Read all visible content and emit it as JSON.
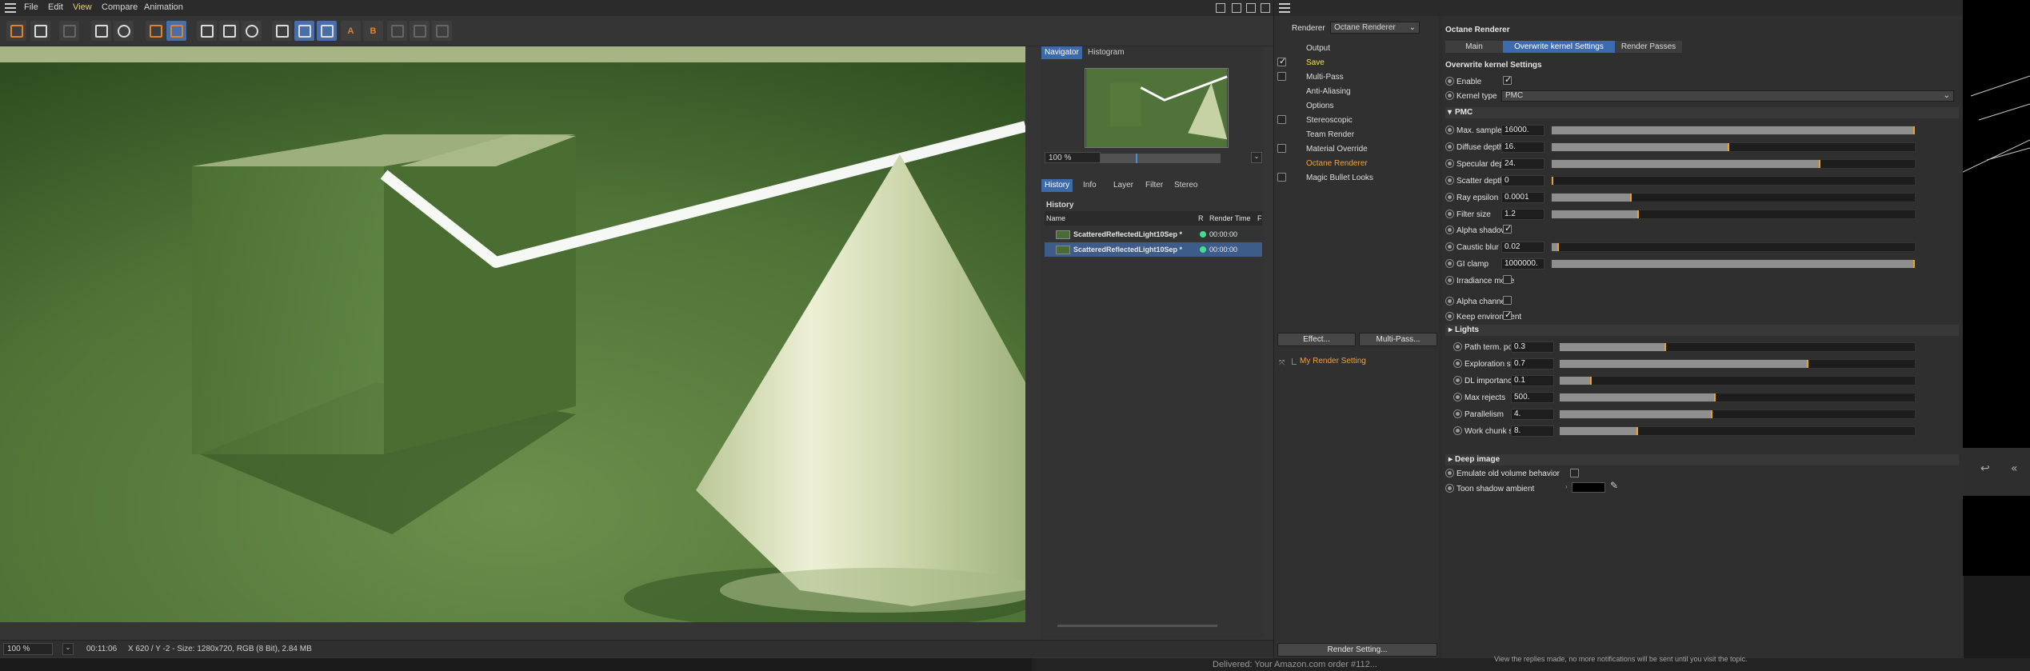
{
  "menubar": {
    "items": [
      "File",
      "Edit",
      "View",
      "Compare",
      "Animation"
    ],
    "active": "View"
  },
  "status": {
    "zoom": "100 %",
    "time": "00:11:06",
    "info": "X 620 / Y -2 - Size: 1280x720, RGB (8 Bit), 2.84 MB"
  },
  "navigator": {
    "tabs": [
      "Navigator",
      "Histogram"
    ],
    "zoom": "100 %",
    "history_tabs": [
      "History",
      "Info",
      "Layer",
      "Filter",
      "Stereo"
    ],
    "history_title": "History",
    "columns": [
      "Name",
      "R",
      "Render Time",
      "F"
    ],
    "rows": [
      {
        "name": "ScatteredReflectedLight10Sep *",
        "time": "00:00:00"
      },
      {
        "name": "ScatteredReflectedLight10Sep *",
        "time": "00:00:00"
      }
    ]
  },
  "render_settings": {
    "renderer_label": "Renderer",
    "renderer_value": "Octane Renderer",
    "nav": [
      {
        "label": "Output",
        "checkbox": false,
        "checked": false
      },
      {
        "label": "Save",
        "checkbox": true,
        "checked": true
      },
      {
        "label": "Multi-Pass",
        "checkbox": true,
        "checked": false
      },
      {
        "label": "Anti-Aliasing",
        "checkbox": false,
        "checked": false
      },
      {
        "label": "Options",
        "checkbox": false,
        "checked": false
      },
      {
        "label": "Stereoscopic",
        "checkbox": true,
        "checked": false
      },
      {
        "label": "Team Render",
        "checkbox": false,
        "checked": false
      },
      {
        "label": "Material Override",
        "checkbox": true,
        "checked": false
      },
      {
        "label": "Octane Renderer",
        "checkbox": false,
        "checked": false
      },
      {
        "label": "Magic Bullet Looks",
        "checkbox": true,
        "checked": false
      }
    ],
    "effect_button": "Effect...",
    "multipass_button": "Multi-Pass...",
    "setting_name": "My Render Setting",
    "render_setting_button": "Render Setting..."
  },
  "octane": {
    "title": "Octane Renderer",
    "tabs": [
      "Main",
      "Overwrite kernel Settings",
      "Render Passes"
    ],
    "active_tab": "Overwrite kernel Settings",
    "section_title": "Overwrite kernel Settings",
    "enable_label": "Enable",
    "kernel_type_label": "Kernel type",
    "kernel_type_value": "PMC",
    "pmc_header": "PMC",
    "params": [
      {
        "label": "Max. samples",
        "value": "16000.",
        "fill": 1.0
      },
      {
        "label": "Diffuse depth",
        "value": "16.",
        "fill": 0.49
      },
      {
        "label": "Specular depth",
        "value": "24.",
        "fill": 0.74
      },
      {
        "label": "Scatter depth",
        "value": "0",
        "fill": 0.0
      },
      {
        "label": "Ray epsilon",
        "value": "0.0001",
        "fill": 0.22
      },
      {
        "label": "Filter size",
        "value": "1.2",
        "fill": 0.24
      },
      {
        "label": "Caustic blur",
        "value": "0.02",
        "fill": 0.02
      },
      {
        "label": "GI clamp",
        "value": "1000000.",
        "fill": 1.0
      }
    ],
    "alpha_shadows": "Alpha shadows",
    "irradiance_mode": "Irradiance mode",
    "alpha_channel": "Alpha channel",
    "keep_environment": "Keep environment",
    "lights_header": "Lights",
    "light_params": [
      {
        "label": "Path term. power",
        "value": "0.3",
        "fill": 0.3
      },
      {
        "label": "Exploration strength",
        "value": "0.7",
        "fill": 0.7
      },
      {
        "label": "DL importance",
        "value": "0.1",
        "fill": 0.09
      },
      {
        "label": "Max rejects",
        "value": "500.",
        "fill": 0.44
      },
      {
        "label": "Parallelism",
        "value": "4.",
        "fill": 0.43
      },
      {
        "label": "Work chunk size",
        "value": "8.",
        "fill": 0.22
      }
    ],
    "deep_image_header": "Deep image",
    "emulate_label": "Emulate old volume behavior",
    "toon_label": "Toon shadow ambient"
  },
  "colors": {
    "accent": "#3b6bb0",
    "highlight": "#f0a33a",
    "slider_marker": "#e8a320"
  },
  "background": {
    "notification": "Delivered: Your Amazon.com order #112...",
    "note_text": "View the replies made, no more notifications will be sent until you visit the topic."
  }
}
